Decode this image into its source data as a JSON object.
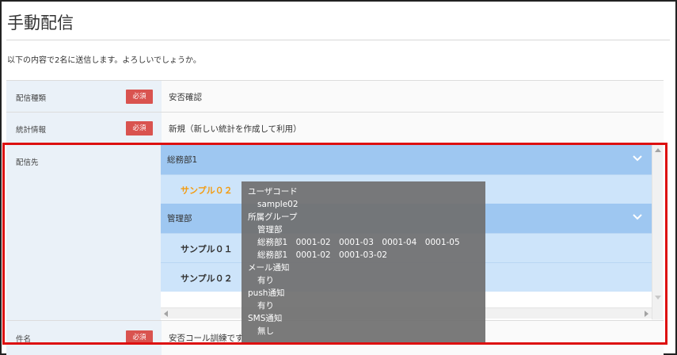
{
  "page": {
    "title": "手動配信",
    "confirm_message": "以下の内容で2名に送信します。よろしいでしょうか。"
  },
  "colors": {
    "required_badge": "#d9534f",
    "label_bg": "#eaf1f8",
    "group_header": "#9ec7f1",
    "member_row": "#cde4fa",
    "selected_member": "#f39c12",
    "highlight_border": "#dd1010",
    "tooltip_bg": "#707070"
  },
  "form": {
    "required_badge": "必須",
    "delivery_type": {
      "label": "配信種類",
      "value": "安否確認"
    },
    "stats_info": {
      "label": "統計情報",
      "value": "新規（新しい統計を作成して利用）"
    },
    "destination": {
      "label": "配信先",
      "groups": [
        {
          "name": "総務部1",
          "icon": "chevron-down-icon",
          "members": [
            "サンプル０２"
          ]
        },
        {
          "name": "管理部",
          "icon": "chevron-down-icon",
          "members": [
            "サンプル０１",
            "サンプル０２"
          ]
        }
      ]
    },
    "subject": {
      "label": "件名",
      "value": "安否コール訓練です"
    }
  },
  "tooltip": {
    "user_code_label": "ユーザコード",
    "user_code_value": "sample02",
    "group_label": "所属グループ",
    "group_lines": [
      "管理部",
      "総務部1　0001-02　0001-03　0001-04　0001-05",
      "総務部1　0001-02　0001-03-02"
    ],
    "mail_label": "メール通知",
    "mail_value": "有り",
    "push_label": "push通知",
    "push_value": "有り",
    "sms_label": "SMS通知",
    "sms_value": "無し"
  }
}
